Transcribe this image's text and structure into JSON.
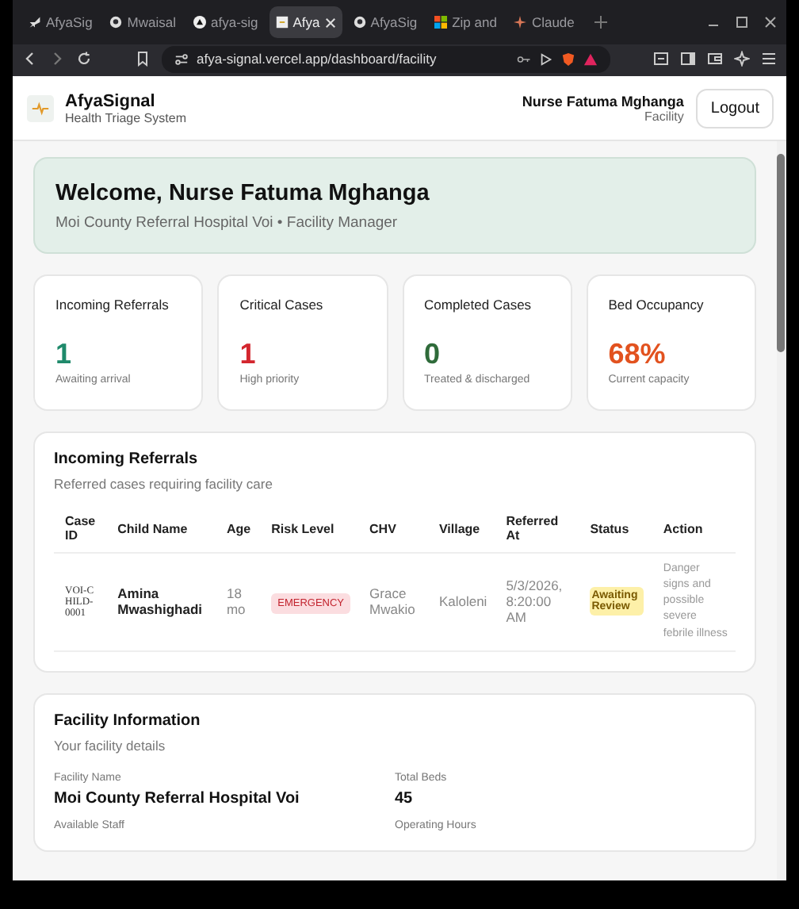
{
  "browser": {
    "tabs": [
      {
        "label": "AfyaSig",
        "selected": false
      },
      {
        "label": "Mwaisal",
        "selected": false
      },
      {
        "label": "afya-sig",
        "selected": false
      },
      {
        "label": "Afya",
        "selected": true
      },
      {
        "label": "AfyaSig",
        "selected": false
      },
      {
        "label": "Zip and",
        "selected": false
      },
      {
        "label": "Claude",
        "selected": false
      }
    ],
    "url": "afya-signal.vercel.app/dashboard/facility"
  },
  "header": {
    "brand": "AfyaSignal",
    "tagline": "Health Triage System",
    "user_name": "Nurse Fatuma Mghanga",
    "user_role": "Facility",
    "logout": "Logout"
  },
  "welcome": {
    "title": "Welcome, Nurse Fatuma Mghanga",
    "subtitle": "Moi County Referral Hospital Voi • Facility Manager"
  },
  "stats": [
    {
      "label": "Incoming Referrals",
      "value": "1",
      "note": "Awaiting arrival",
      "color": "#1f8a6b"
    },
    {
      "label": "Critical Cases",
      "value": "1",
      "note": "High priority",
      "color": "#d3262e"
    },
    {
      "label": "Completed Cases",
      "value": "0",
      "note": "Treated & discharged",
      "color": "#2f6b3a"
    },
    {
      "label": "Bed Occupancy",
      "value": "68%",
      "note": "Current capacity",
      "color": "#e2521f"
    }
  ],
  "referrals": {
    "title": "Incoming Referrals",
    "subtitle": "Referred cases requiring facility care",
    "table": {
      "columns": [
        "Case ID",
        "Child Name",
        "Age",
        "Risk Level",
        "CHV",
        "Village",
        "Referred At",
        "Status",
        "Action"
      ],
      "rows": [
        {
          "case_id": "VOI-CHILD-0001",
          "child_name": "Amina Mwashighadi",
          "age": "18 mo",
          "risk_level": "EMERGENCY",
          "chv": "Grace Mwakio",
          "village": "Kaloleni",
          "referred_at": "5/3/2026, 8:20:00 AM",
          "status": "Awaiting Review",
          "action": "Danger signs and possible severe febrile illness"
        }
      ]
    }
  },
  "facility": {
    "title": "Facility Information",
    "subtitle": "Your facility details",
    "fields": [
      {
        "label": "Facility Name",
        "value": "Moi County Referral Hospital Voi"
      },
      {
        "label": "Total Beds",
        "value": "45"
      },
      {
        "label": "Available Staff"
      },
      {
        "label": "Operating Hours"
      }
    ]
  }
}
